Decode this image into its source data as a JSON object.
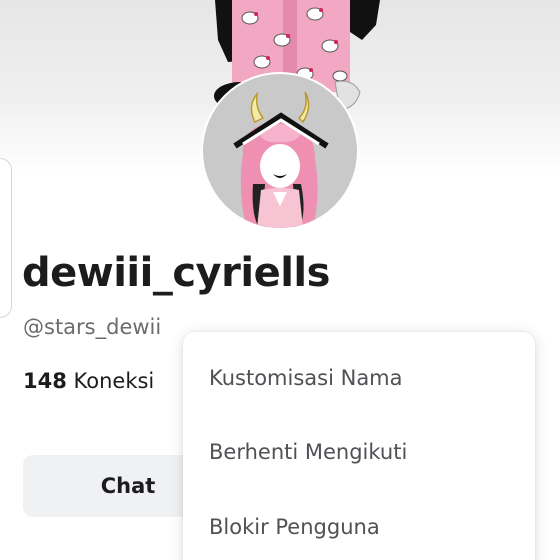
{
  "profile": {
    "display_name": "dewiii_cyriells",
    "username": "@stars_dewii",
    "connections_count": "148",
    "connections_label": "Koneksi"
  },
  "actions": {
    "chat_label": "Chat"
  },
  "menu": {
    "items": [
      {
        "label": "Kustomisasi Nama"
      },
      {
        "label": "Berhenti Mengikuti"
      },
      {
        "label": "Blokir Pengguna"
      }
    ]
  }
}
